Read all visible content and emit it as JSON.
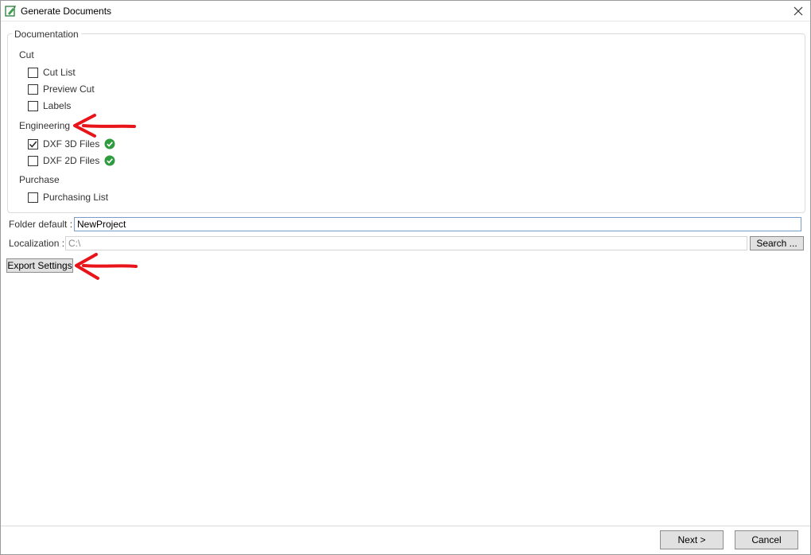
{
  "window": {
    "title": "Generate Documents"
  },
  "documentation": {
    "legend": "Documentation",
    "sections": {
      "cut": {
        "label": "Cut",
        "items": [
          {
            "label": "Cut List",
            "checked": false
          },
          {
            "label": "Preview Cut",
            "checked": false
          },
          {
            "label": "Labels",
            "checked": false
          }
        ]
      },
      "engineering": {
        "label": "Engineering",
        "items": [
          {
            "label": "DXF 3D Files",
            "checked": true
          },
          {
            "label": "DXF 2D Files",
            "checked": false
          }
        ]
      },
      "purchase": {
        "label": "Purchase",
        "items": [
          {
            "label": "Purchasing List",
            "checked": false
          }
        ]
      }
    }
  },
  "folder": {
    "label": "Folder default :",
    "value": "NewProject"
  },
  "localization": {
    "label": "Localization :",
    "value": "C:\\",
    "search_label": "Search ..."
  },
  "export_settings_label": "Export Settings",
  "footer": {
    "next_label": "Next >",
    "cancel_label": "Cancel"
  },
  "colors": {
    "annotation_arrow": "#e8141a",
    "check_ok": "#2e9b3e"
  },
  "icons": {
    "app": "document-edit-icon",
    "close": "close-icon",
    "ok": "check-circle-icon"
  }
}
